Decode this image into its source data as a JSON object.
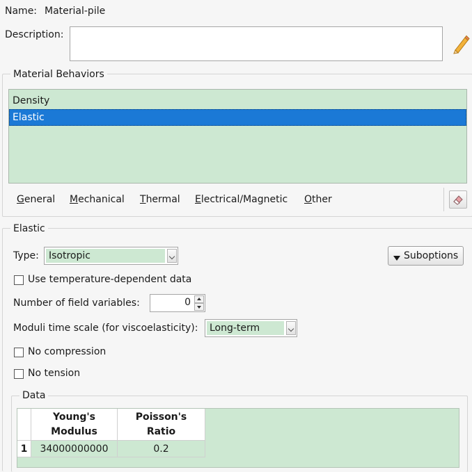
{
  "name": {
    "label": "Name:",
    "value": "Material-pile"
  },
  "description": {
    "label": "Description:",
    "value": ""
  },
  "material_behaviors": {
    "title": "Material Behaviors",
    "items": [
      {
        "label": "Density",
        "selected": false
      },
      {
        "label": "Elastic",
        "selected": true
      }
    ]
  },
  "menus": [
    {
      "mnemonic": "G",
      "rest": "eneral"
    },
    {
      "mnemonic": "M",
      "rest": "echanical"
    },
    {
      "mnemonic": "T",
      "rest": "hermal"
    },
    {
      "mnemonic": "E",
      "rest": "lectrical/Magnetic"
    },
    {
      "mnemonic": "O",
      "rest": "ther"
    }
  ],
  "elastic": {
    "title": "Elastic",
    "type_label": "Type:",
    "type_value": "Isotropic",
    "suboptions_label": "Suboptions",
    "use_temp_label": "Use temperature-dependent data",
    "field_vars_label": "Number of field variables:",
    "field_vars_value": "0",
    "moduli_label": "Moduli time scale (for viscoelasticity):",
    "moduli_value": "Long-term",
    "no_compression_label": "No compression",
    "no_tension_label": "No tension",
    "data": {
      "title": "Data",
      "headers": [
        {
          "line1": "Young's",
          "line2": "Modulus"
        },
        {
          "line1": "Poisson's",
          "line2": "Ratio"
        }
      ],
      "rows": [
        {
          "index": "1",
          "values": [
            "34000000000",
            "0.2"
          ]
        }
      ]
    }
  },
  "colors": {
    "accent": "#1b79d6",
    "cell_green": "#cde8d2"
  },
  "icons": [
    "pencil-icon",
    "eraser-icon",
    "triangle-down-icon",
    "spinner-arrows-icon"
  ]
}
